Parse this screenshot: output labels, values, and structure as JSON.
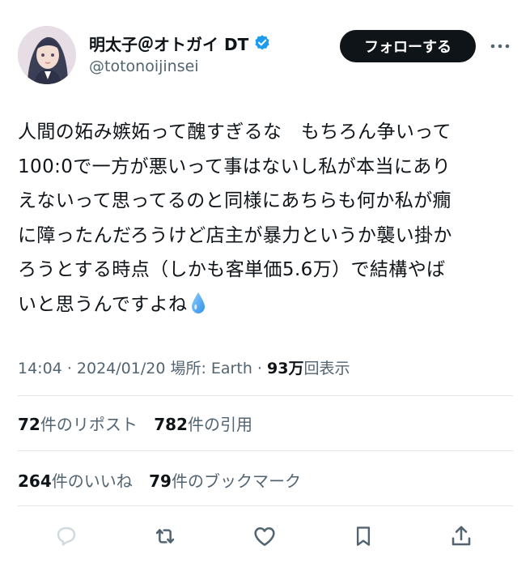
{
  "author": {
    "display_name": "明太子＠オトガイ DT",
    "handle": "@totonoijinsei",
    "verified_icon": "verified-badge-icon",
    "avatar_icon": "avatar"
  },
  "header": {
    "follow_label": "フォローする",
    "more_icon": "more-icon"
  },
  "tweet": {
    "lines": [
      "人間の妬み嫉妬って醜すぎるな　もちろん争いって",
      "100:0で一方が悪いって事はないし私が本当にあり",
      "えないって思ってるのと同様にあちらも何か私が癇",
      "に障ったんだろうけど店主が暴力というか襲い掛か",
      "ろうとする時点（しかも客単価5.6万）で結構やば",
      "いと思うんですよね"
    ],
    "emoji_icon": "droplet-icon"
  },
  "meta": {
    "time": "14:04",
    "date": "2024/01/20",
    "location": "場所: Earth",
    "views_count": "93万",
    "views_label": "回表示",
    "separator": "·"
  },
  "stats": {
    "reposts_count": "72",
    "reposts_label": "件のリポスト",
    "quotes_count": "782",
    "quotes_label": "件の引用",
    "likes_count": "264",
    "likes_label": "件のいいね",
    "bookmarks_count": "79",
    "bookmarks_label": "件のブックマーク"
  },
  "actions": {
    "reply_icon": "reply-icon",
    "repost_icon": "repost-icon",
    "like_icon": "heart-icon",
    "bookmark_icon": "bookmark-icon",
    "share_icon": "share-icon"
  },
  "colors": {
    "text_primary": "#0f1419",
    "text_secondary": "#536471",
    "verified_blue": "#1d9bf0",
    "divider": "#e4e7ea",
    "disabled_icon": "#cfd9de"
  }
}
